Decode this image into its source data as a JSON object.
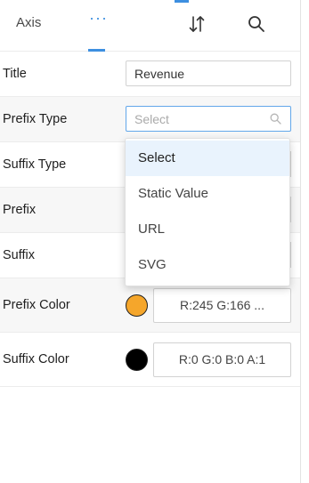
{
  "header": {
    "tabs": [
      {
        "label": "Axis"
      },
      {
        "label": "···"
      }
    ],
    "active_tab_color": "#3d8fe0",
    "icons": {
      "sort": "sort-icon",
      "search": "search-icon"
    }
  },
  "rows": {
    "title": {
      "label": "Title",
      "value": "Revenue"
    },
    "prefix_type": {
      "label": "Prefix Type",
      "placeholder": "Select"
    },
    "suffix_type": {
      "label": "Suffix Type"
    },
    "prefix": {
      "label": "Prefix"
    },
    "suffix": {
      "label": "Suffix"
    },
    "prefix_color": {
      "label": "Prefix Color",
      "swatch": "#f5a62b",
      "value": "R:245 G:166 ..."
    },
    "suffix_color": {
      "label": "Suffix Color",
      "swatch": "#000000",
      "value": "R:0 G:0 B:0 A:1"
    }
  },
  "dropdown": {
    "options": [
      "Select",
      "Static Value",
      "URL",
      "SVG"
    ],
    "selected_index": 0
  }
}
